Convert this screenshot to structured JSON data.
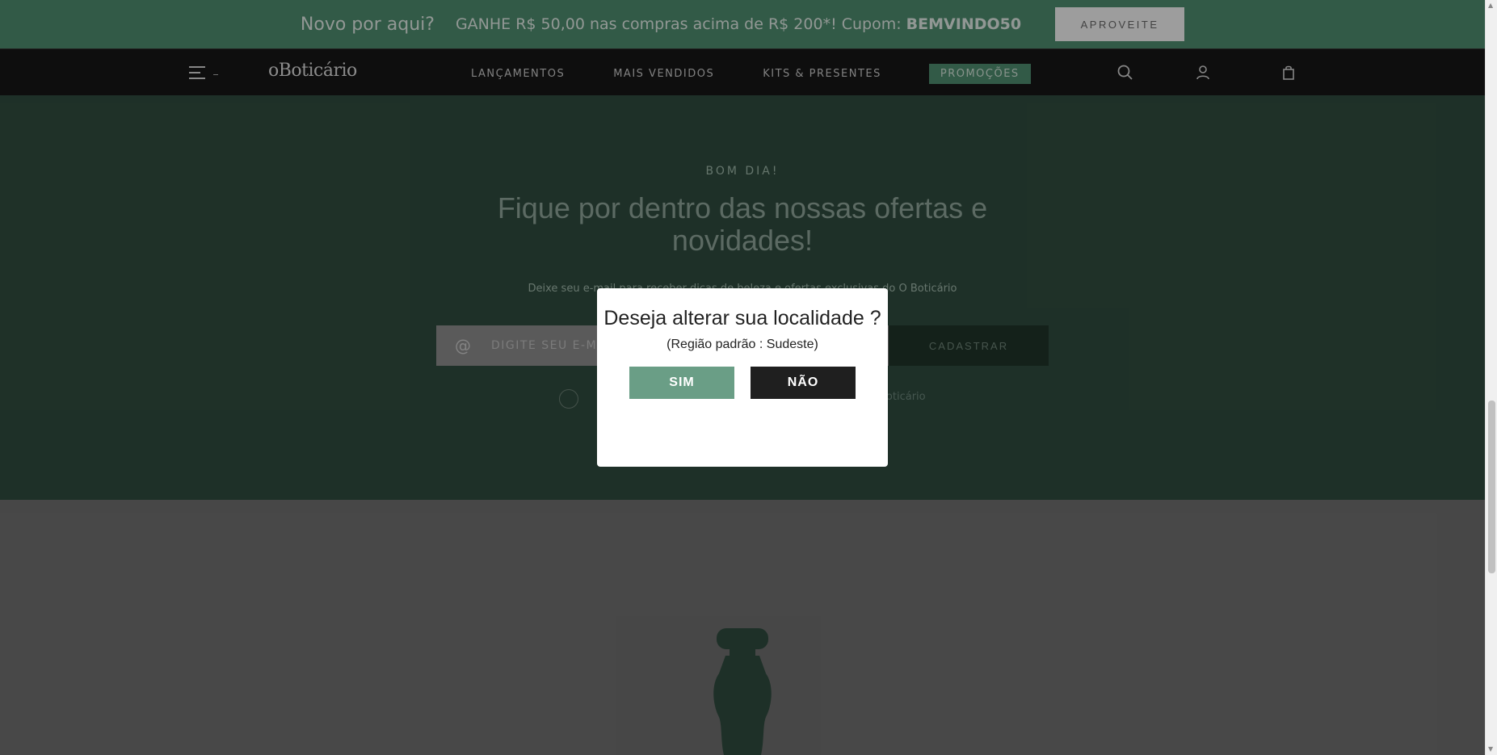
{
  "promo_bar": {
    "question": "Novo por aqui?",
    "offer_text": "GANHE R$ 50,00 nas compras acima de R$ 200*! Cupom:",
    "coupon_code": "BEMVINDO50",
    "cta_label": "APROVEITE"
  },
  "nav": {
    "logo": "oBoticário",
    "links": [
      "LANÇAMENTOS",
      "MAIS VENDIDOS",
      "KITS & PRESENTES"
    ],
    "promo_link": "PROMOÇÕES",
    "icons": [
      "menu-icon",
      "search-icon",
      "user-icon",
      "bag-icon"
    ]
  },
  "newsletter": {
    "greeting": "BOM DIA!",
    "headline": "Fique por dentro das nossas ofertas e novidades!",
    "subcopy": "Deixe seu e-mail para receber dicas de beleza e ofertas exclusivas do O Boticário",
    "email_placeholder": "DIGITE SEU E-MAIL",
    "submit_label": "CADASTRAR",
    "consent_tail": "Boticário"
  },
  "modal": {
    "title": "Deseja alterar sua localidade ?",
    "subtitle": "(Região padrão : Sudeste)",
    "yes_label": "SIM",
    "no_label": "NÃO"
  },
  "colors": {
    "brand_green": "#4d8a6d",
    "newsletter_bg": "#2f4b3e",
    "modal_yes": "#6a9e86",
    "modal_no": "#1f1f1f"
  }
}
